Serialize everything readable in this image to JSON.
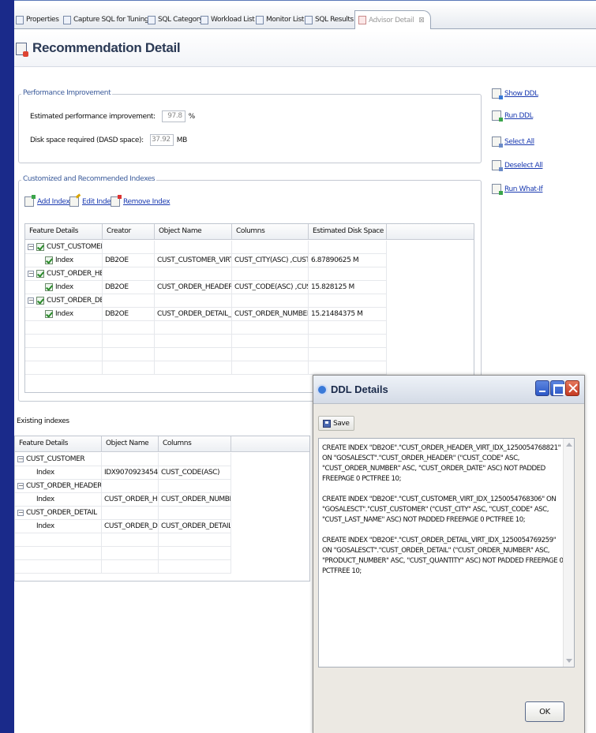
{
  "tabs": [
    {
      "label": "Properties"
    },
    {
      "label": "Capture SQL for Tuning"
    },
    {
      "label": "SQL Category"
    },
    {
      "label": "Workload List"
    },
    {
      "label": "Monitor List"
    },
    {
      "label": "SQL Results"
    },
    {
      "label": "Advisor Detail"
    }
  ],
  "tab_close_glyph": "⊠",
  "page": {
    "title": "Recommendation Detail"
  },
  "performance": {
    "group_title": "Performance Improvement",
    "est_label": "Estimated performance improvement:",
    "est_value": "97.8",
    "est_unit": "%",
    "disk_label": "Disk space required (DASD space):",
    "disk_value": "37.92",
    "disk_unit": "MB"
  },
  "actions": {
    "show_ddl": "Show DDL",
    "run_ddl": "Run DDL",
    "select_all": "Select All",
    "deselect_all": "Deselect All",
    "run_what_if": "Run What-If"
  },
  "recommended": {
    "group_title": "Customized and Recommended Indexes",
    "add": "Add Index",
    "edit": "Edit Index",
    "remove": "Remove Index",
    "columns": [
      "Feature Details",
      "Creator",
      "Object Name",
      "Columns",
      "Estimated Disk Space"
    ],
    "rows": [
      {
        "feature": "CUST_CUSTOMER",
        "creator": "",
        "object": "",
        "cols": "",
        "space": ""
      },
      {
        "feature": "Index",
        "creator": "DB2OE",
        "object": "CUST_CUSTOMER_VIRT_I...",
        "cols": "CUST_CITY(ASC) ,CUST_C...",
        "space": "6.87890625 M"
      },
      {
        "feature": "CUST_ORDER_HEADER",
        "creator": "",
        "object": "",
        "cols": "",
        "space": ""
      },
      {
        "feature": "Index",
        "creator": "DB2OE",
        "object": "CUST_ORDER_HEADER_VI...",
        "cols": "CUST_CODE(ASC) ,CUST_...",
        "space": "15.828125 M"
      },
      {
        "feature": "CUST_ORDER_DETAIL",
        "creator": "",
        "object": "",
        "cols": "",
        "space": ""
      },
      {
        "feature": "Index",
        "creator": "DB2OE",
        "object": "CUST_ORDER_DETAIL_VI...",
        "cols": "CUST_ORDER_NUMBER(A...",
        "space": "15.21484375 M"
      }
    ]
  },
  "existing": {
    "title": "Existing indexes",
    "columns": [
      "Feature Details",
      "Object Name",
      "Columns"
    ],
    "rows": [
      {
        "feature": "CUST_CUSTOMER",
        "object": "",
        "cols": ""
      },
      {
        "feature": "Index",
        "object": "IDX9070923454...",
        "cols": "CUST_CODE(ASC)"
      },
      {
        "feature": "CUST_ORDER_HEADER",
        "object": "",
        "cols": ""
      },
      {
        "feature": "Index",
        "object": "CUST_ORDER_H...",
        "cols": "CUST_ORDER_NUMBER(A..."
      },
      {
        "feature": "CUST_ORDER_DETAIL",
        "object": "",
        "cols": ""
      },
      {
        "feature": "Index",
        "object": "CUST_ORDER_D...",
        "cols": "CUST_ORDER_DETAIL_CO..."
      }
    ]
  },
  "dialog": {
    "title": "DDL Details",
    "save": "Save",
    "ok": "OK",
    "ddl": [
      "CREATE INDEX \"DB2OE\".\"CUST_ORDER_HEADER_VIRT_IDX_1250054768821\" ON \"GOSALESCT\".\"CUST_ORDER_HEADER\" (\"CUST_CODE\" ASC, \"CUST_ORDER_NUMBER\" ASC, \"CUST_ORDER_DATE\" ASC) NOT PADDED  FREEPAGE 0 PCTFREE 10;",
      "CREATE INDEX \"DB2OE\".\"CUST_CUSTOMER_VIRT_IDX_1250054768306\" ON \"GOSALESCT\".\"CUST_CUSTOMER\" (\"CUST_CITY\" ASC, \"CUST_CODE\" ASC, \"CUST_LAST_NAME\" ASC) NOT PADDED  FREEPAGE 0 PCTFREE 10;",
      "CREATE INDEX \"DB2OE\".\"CUST_ORDER_DETAIL_VIRT_IDX_1250054769259\" ON \"GOSALESCT\".\"CUST_ORDER_DETAIL\" (\"CUST_ORDER_NUMBER\" ASC, \"PRODUCT_NUMBER\" ASC, \"CUST_QUANTITY\" ASC) NOT PADDED  FREEPAGE 0 PCTFREE 10;"
    ]
  },
  "colors": {
    "accent": "#1a3ab0",
    "group_title": "#3a5a9a",
    "left_bar": "#1a2a8a"
  }
}
